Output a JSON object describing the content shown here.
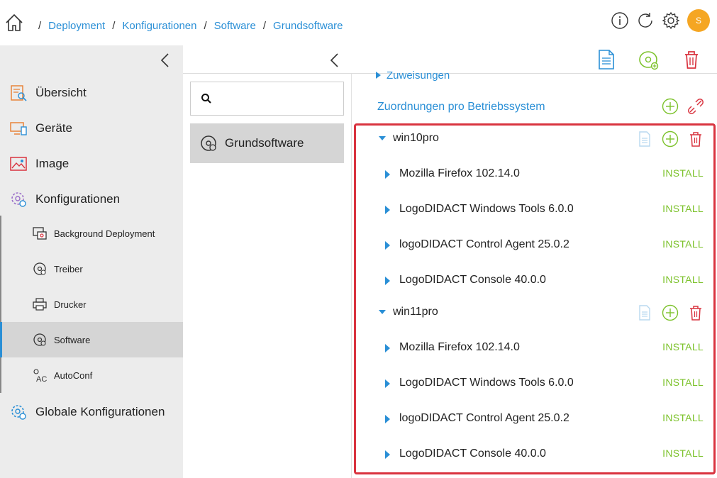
{
  "breadcrumb": {
    "items": [
      "Deployment",
      "Konfigurationen",
      "Software",
      "Grundsoftware"
    ],
    "separator": "/"
  },
  "user": {
    "initial": "S",
    "avatar_color": "#f5a623"
  },
  "sidebar": {
    "items": [
      {
        "label": "Übersicht",
        "icon": "overview-icon"
      },
      {
        "label": "Geräte",
        "icon": "devices-icon"
      },
      {
        "label": "Image",
        "icon": "image-icon"
      },
      {
        "label": "Konfigurationen",
        "icon": "configurations-icon"
      },
      {
        "label": "Globale Konfigurationen",
        "icon": "global-configurations-icon"
      }
    ],
    "sub_items": [
      {
        "label": "Background Deployment",
        "icon": "background-deployment-icon"
      },
      {
        "label": "Treiber",
        "icon": "driver-icon"
      },
      {
        "label": "Drucker",
        "icon": "printer-icon"
      },
      {
        "label": "Software",
        "icon": "software-icon",
        "active": true
      },
      {
        "label": "AutoConf",
        "icon": "autoconf-icon"
      }
    ]
  },
  "middle": {
    "search_placeholder": "",
    "selected_item": "Grundsoftware"
  },
  "main": {
    "assignments_label": "Zuweisungen",
    "per_os_label": "Zuordnungen pro Betriebssystem",
    "os_groups": [
      {
        "name": "win10pro",
        "software": [
          {
            "name": "Mozilla Firefox 102.14.0",
            "action": "INSTALL"
          },
          {
            "name": "LogoDIDACT Windows Tools 6.0.0",
            "action": "INSTALL"
          },
          {
            "name": "logoDIDACT Control Agent 25.0.2",
            "action": "INSTALL"
          },
          {
            "name": "LogoDIDACT Console 40.0.0",
            "action": "INSTALL"
          }
        ]
      },
      {
        "name": "win11pro",
        "software": [
          {
            "name": "Mozilla Firefox 102.14.0",
            "action": "INSTALL"
          },
          {
            "name": "LogoDIDACT Windows Tools 6.0.0",
            "action": "INSTALL"
          },
          {
            "name": "logoDIDACT Control Agent 25.0.2",
            "action": "INSTALL"
          },
          {
            "name": "LogoDIDACT Console 40.0.0",
            "action": "INSTALL"
          }
        ]
      }
    ]
  },
  "colors": {
    "accent": "#2a8fd6",
    "install": "#7cc22b",
    "danger": "#d9333f",
    "add": "#7cc22b"
  }
}
